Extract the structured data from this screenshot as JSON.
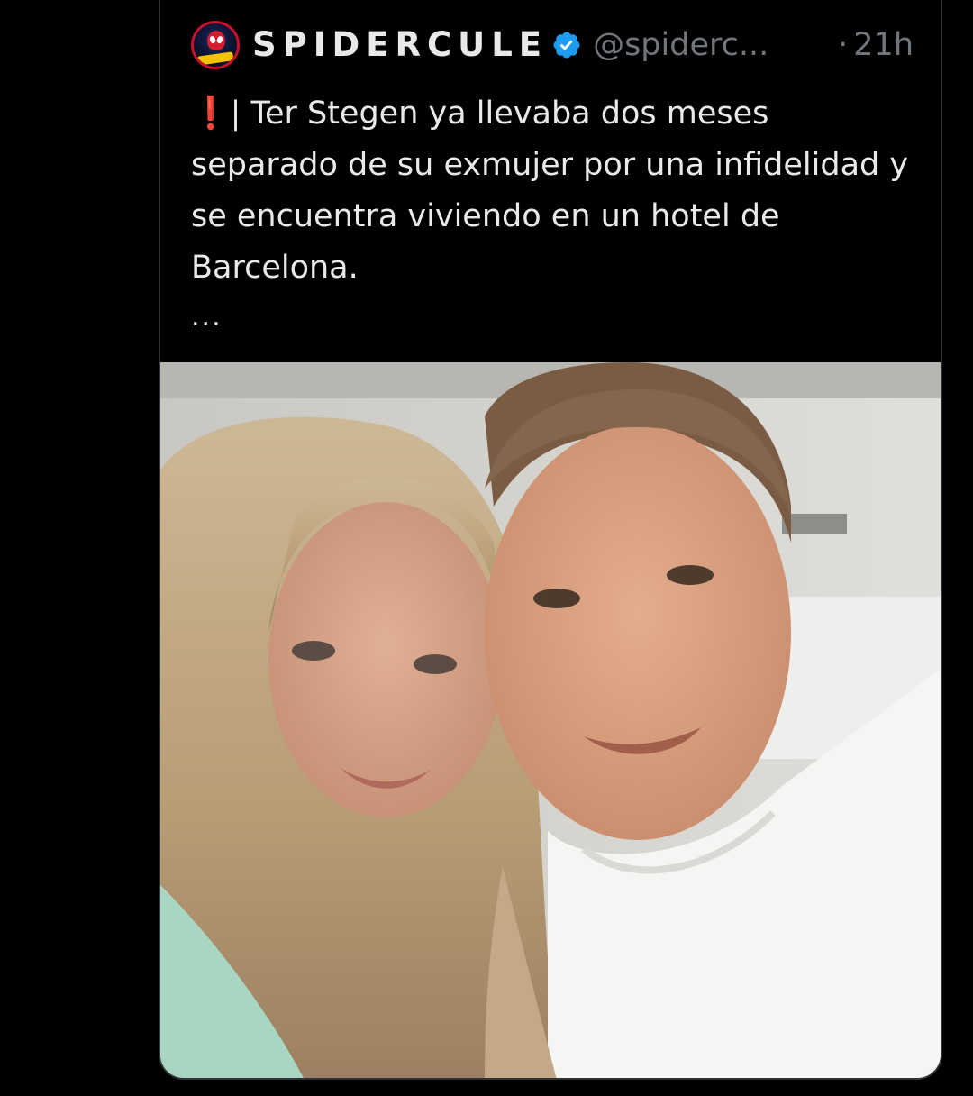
{
  "tweet": {
    "author": {
      "display_name": "SPIDERCULE",
      "handle": "@spiderc...",
      "verified": true,
      "avatar_icon": "spiderman-avatar-icon"
    },
    "time_separator": "·",
    "time": "21h",
    "alert_icon": "❗",
    "text": "| Ter Stegen ya llevaba dos meses separado de su exmujer por una infidelidad y se encuentra viviendo en un hotel de Barcelona.",
    "more_indicator": "...",
    "media": {
      "type": "photo",
      "icon": "couple-selfie-photo"
    }
  },
  "colors": {
    "background": "#000000",
    "text_primary": "#e7e9ea",
    "text_secondary": "#71767b",
    "verified_blue": "#1d9bf0",
    "card_border": "#2f3336",
    "alert_red": "#e0242e"
  }
}
